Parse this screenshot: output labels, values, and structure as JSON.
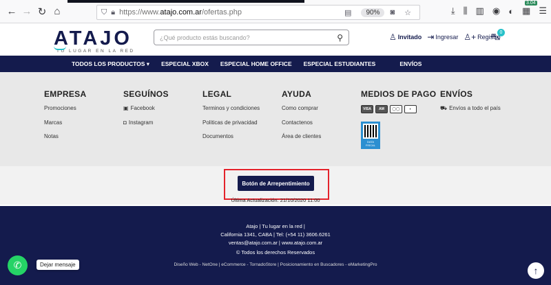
{
  "browser": {
    "url_prefix": "https://www.",
    "url_host": "atajo.com.ar",
    "url_path": "/ofertas.php",
    "zoom": "90%",
    "ext_badge": "3.04"
  },
  "header": {
    "logo_text": "ATAJO",
    "logo_tagline": "TU LUGAR EN LA RED",
    "search_placeholder": "¿Qué producto estás buscando?",
    "invitado": "Invitado",
    "ingresar": "Ingresar",
    "registro": "Registro",
    "cart_count": "0"
  },
  "nav": {
    "items": [
      "TODOS LOS PRODUCTOS ▾",
      "ESPECIAL XBOX",
      "ESPECIAL HOME OFFICE",
      "ESPECIAL ESTUDIANTES",
      "ENVÍOS"
    ]
  },
  "footer": {
    "empresa": {
      "title": "EMPRESA",
      "items": [
        "Promociones",
        "Marcas",
        "Notas"
      ]
    },
    "seguinos": {
      "title": "SEGUÍNOS",
      "items": [
        "Facebook",
        "Instagram"
      ]
    },
    "legal": {
      "title": "LEGAL",
      "items": [
        "Terminos y condiciones",
        "Politicas de privacidad",
        "Documentos"
      ]
    },
    "ayuda": {
      "title": "AYUDA",
      "items": [
        "Como comprar",
        "Contactenos",
        "Área de clientes"
      ]
    },
    "pagos": {
      "title": "MEDIOS DE PAGO",
      "qr_label": "DATA FISCAL"
    },
    "envios": {
      "title": "ENVÍOS",
      "item": "Envíos a todo el país"
    }
  },
  "arrepentimiento": {
    "button": "Botón de Arrepentimiento",
    "update": "Última Actualización: 21/10/2020 11:00"
  },
  "bottom": {
    "line1": "Atajo | Tu lugar en la red |",
    "line2": "California 1341, CABA | Tel: (+54 11) 3606.6261",
    "line3": "ventas@atajo.com.ar | www.atajo.com.ar",
    "rights": "© Todos los derechos Reservados",
    "credits": "Diseño Web - NetOne | eCommerce - TornadoStore | Posicionamiento en Buscadores - eMarketingPro"
  },
  "whatsapp": {
    "tip": "Dejar mensaje"
  }
}
